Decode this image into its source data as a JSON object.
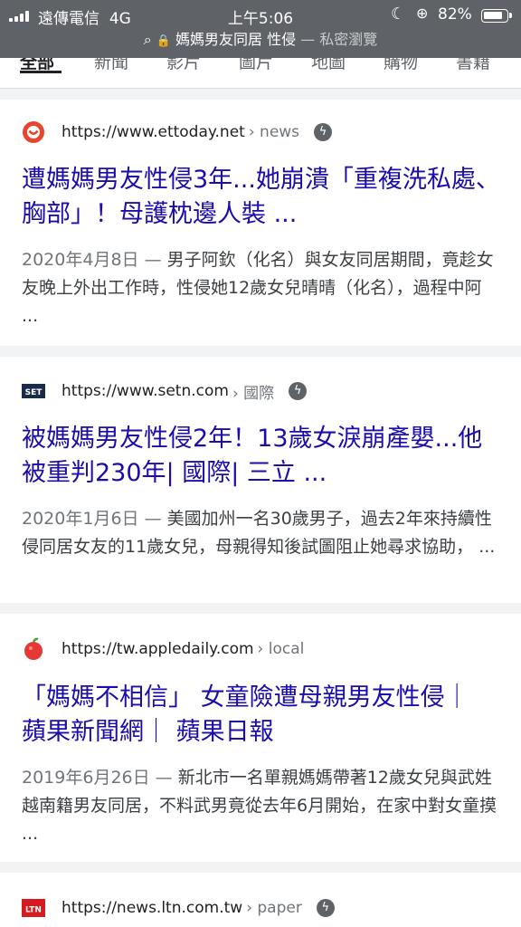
{
  "status_bar": {
    "carrier": "遠傳電信",
    "network": "4G",
    "time": "上午5:06",
    "battery": "82%",
    "battery_level": 0.82
  },
  "url_bar": {
    "search_glyph": "⌕",
    "lock_glyph": "🔒",
    "query": "媽媽男友同居 性侵",
    "mode": " — 私密瀏覽"
  },
  "tabs": [
    "全部",
    "新聞",
    "影片",
    "圖片",
    "地圖",
    "購物",
    "書籍"
  ],
  "results": [
    {
      "url": "https://www.ettoday.net",
      "sub": "› news",
      "title": "遭媽媽男友性侵3年...她崩潰「重複洗私處、胸部」！母護枕邊人裝 ...",
      "date": "2020年4月8日 — ",
      "snippet": "男子阿欽（化名）與女友同居期間，竟趁女友晚上外出工作時，性侵她12歲女兒晴晴（化名），過程中阿 ...",
      "favicon": "ettoday-icon",
      "amp": true
    },
    {
      "url": "https://www.setn.com",
      "sub": "› 國際",
      "title": "被媽媽男友性侵2年！13歲女淚崩產嬰...他被重判230年| 國際| 三立 ...",
      "date": "2020年1月6日 — ",
      "snippet": "美國加州一名30歲男子，過去2年來持續性侵同居女友的11歲女兒，母親得知後試圖阻止她尋求協助， ...",
      "favicon": "setn-icon",
      "favicon_text": "SET",
      "amp": true
    },
    {
      "url": "https://tw.appledaily.com",
      "sub": "› local",
      "title": "「媽媽不相信」 女童險遭母親男友性侵｜ 蘋果新聞網｜ 蘋果日報",
      "date": "2019年6月26日 — ",
      "snippet": "新北市一名單親媽媽帶著12歲女兒與武姓越南籍男友同居，不料武男竟從去年6月開始，在家中對女童摸 ...",
      "favicon": "appledaily-icon",
      "amp": false
    },
    {
      "url": "https://news.ltn.com.tw",
      "sub": "› paper",
      "title": "",
      "date": "",
      "snippet": "",
      "favicon": "ltn-icon",
      "favicon_text": "LTN",
      "amp": true
    }
  ],
  "amp_glyph": "ϟ"
}
